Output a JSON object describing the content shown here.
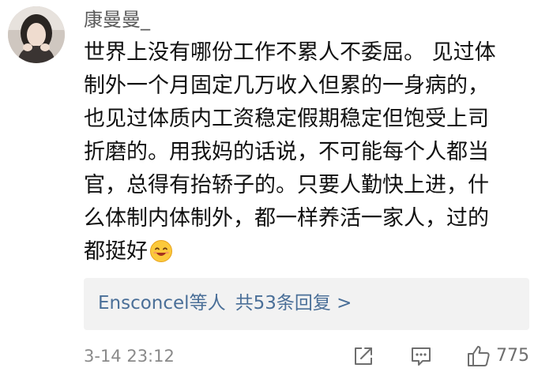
{
  "comment": {
    "username": "康曼曼_",
    "avatar_icon": "user-avatar-photo",
    "text_lines": [
      "世界上没有哪份工作不累人不委屈。 见过体",
      "制外一个月固定几万收入但累的一身病的，",
      "也见过体质内工资稳定假期稳定但饱受上司",
      "折磨的。用我妈的话说，不可能每个人都当",
      "官，总得有抬轿子的。只要人勤快上进，什",
      "么体制内体制外，都一样养活一家人，过的",
      "都挺好"
    ],
    "emoji_icon": "smiling-face-emoji",
    "replies": {
      "users": "Ensconcel等人",
      "count_label": "共53条回复 >"
    },
    "timestamp": "3-14 23:12",
    "actions": {
      "share_icon": "share-icon",
      "comment_icon": "comment-icon",
      "like_icon": "thumbs-up-icon",
      "like_count": "775"
    },
    "colors": {
      "link": "#4a6f98",
      "meta": "#8a8a8a",
      "reply_bg": "#f2f2f2"
    }
  }
}
